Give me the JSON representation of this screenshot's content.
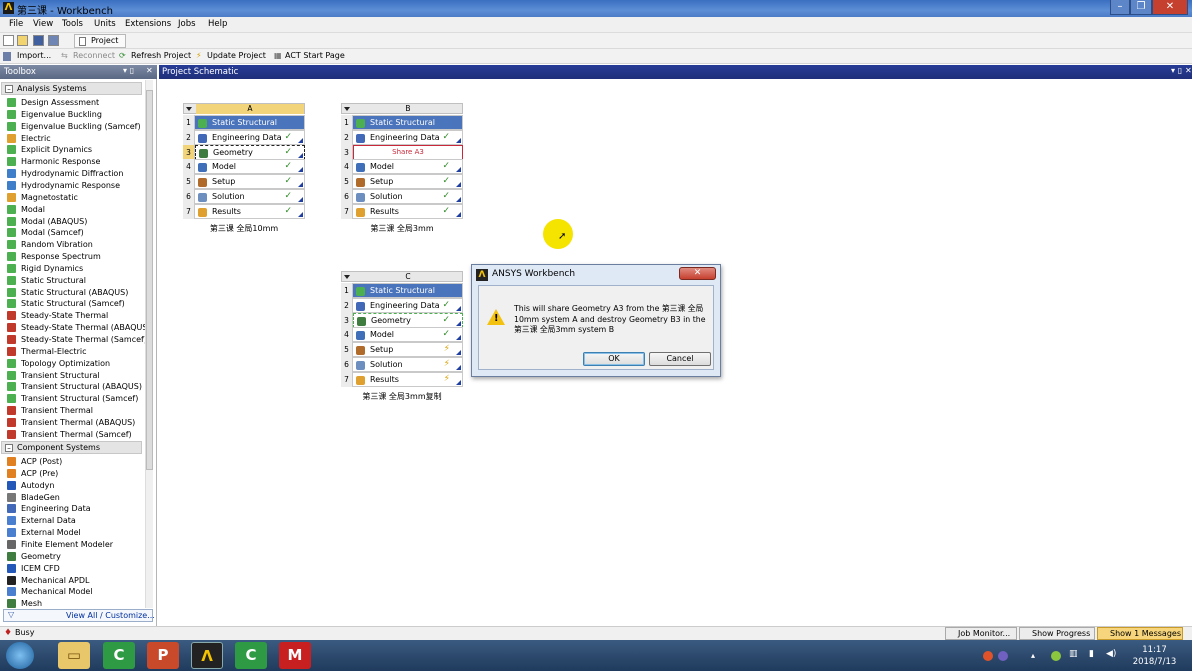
{
  "window": {
    "title": "第三课 - Workbench"
  },
  "menu": [
    "File",
    "View",
    "Tools",
    "Units",
    "Extensions",
    "Jobs",
    "Help"
  ],
  "toolbar1": {
    "project_tab": "Project"
  },
  "toolbar2": {
    "import": "Import...",
    "reconnect": "Reconnect",
    "refresh": "Refresh Project",
    "update": "Update Project",
    "act": "ACT Start Page"
  },
  "toolbox": {
    "title": "Toolbox",
    "analysis_header": "Analysis Systems",
    "analysis_items": [
      "Design Assessment",
      "Eigenvalue Buckling",
      "Eigenvalue Buckling (Samcef)",
      "Electric",
      "Explicit Dynamics",
      "Harmonic Response",
      "Hydrodynamic Diffraction",
      "Hydrodynamic Response",
      "Magnetostatic",
      "Modal",
      "Modal (ABAQUS)",
      "Modal (Samcef)",
      "Random Vibration",
      "Response Spectrum",
      "Rigid Dynamics",
      "Static Structural",
      "Static Structural (ABAQUS)",
      "Static Structural (Samcef)",
      "Steady-State Thermal",
      "Steady-State Thermal (ABAQUS)",
      "Steady-State Thermal (Samcef)",
      "Thermal-Electric",
      "Topology Optimization",
      "Transient Structural",
      "Transient Structural (ABAQUS)",
      "Transient Structural (Samcef)",
      "Transient Thermal",
      "Transient Thermal (ABAQUS)",
      "Transient Thermal (Samcef)"
    ],
    "component_header": "Component Systems",
    "component_items": [
      "ACP (Post)",
      "ACP (Pre)",
      "Autodyn",
      "BladeGen",
      "Engineering Data",
      "External Data",
      "External Model",
      "Finite Element Modeler",
      "Geometry",
      "ICEM CFD",
      "Mechanical APDL",
      "Mechanical Model",
      "Mesh"
    ],
    "view_all": "View All / Customize..."
  },
  "schematic": {
    "title": "Project Schematic",
    "systems": [
      {
        "letter": "A",
        "caption": "第三课 全局10mm",
        "rows": [
          {
            "n": "1",
            "label": "Static Structural",
            "check": ""
          },
          {
            "n": "2",
            "label": "Engineering Data",
            "check": "✓"
          },
          {
            "n": "3",
            "label": "Geometry",
            "check": "✓"
          },
          {
            "n": "4",
            "label": "Model",
            "check": "✓"
          },
          {
            "n": "5",
            "label": "Setup",
            "check": "✓"
          },
          {
            "n": "6",
            "label": "Solution",
            "check": "✓"
          },
          {
            "n": "7",
            "label": "Results",
            "check": "✓"
          }
        ]
      },
      {
        "letter": "B",
        "caption": "第三课 全局3mm",
        "rows": [
          {
            "n": "1",
            "label": "Static Structural",
            "check": ""
          },
          {
            "n": "2",
            "label": "Engineering Data",
            "check": "✓"
          },
          {
            "n": "3",
            "label": "Share A3",
            "check": ""
          },
          {
            "n": "4",
            "label": "Model",
            "check": "✓"
          },
          {
            "n": "5",
            "label": "Setup",
            "check": "✓"
          },
          {
            "n": "6",
            "label": "Solution",
            "check": "✓"
          },
          {
            "n": "7",
            "label": "Results",
            "check": "✓"
          }
        ]
      },
      {
        "letter": "C",
        "caption": "第三课 全局3mm复制",
        "rows": [
          {
            "n": "1",
            "label": "Static Structural",
            "check": ""
          },
          {
            "n": "2",
            "label": "Engineering Data",
            "check": "✓"
          },
          {
            "n": "3",
            "label": "Geometry",
            "check": "✓"
          },
          {
            "n": "4",
            "label": "Model",
            "check": "✓"
          },
          {
            "n": "5",
            "label": "Setup",
            "check": "⚡"
          },
          {
            "n": "6",
            "label": "Solution",
            "check": "⚡"
          },
          {
            "n": "7",
            "label": "Results",
            "check": "⚡"
          }
        ]
      }
    ]
  },
  "dialog": {
    "title": "ANSYS Workbench",
    "message": "This will share Geometry A3 from the 第三课 全局 10mm system A and destroy Geometry B3 in the 第三课 全局3mm system B",
    "ok": "OK",
    "cancel": "Cancel"
  },
  "status": {
    "busy": "Busy",
    "job_monitor": "Job Monitor...",
    "show_progress": "Show Progress",
    "messages": "Show 1 Messages"
  },
  "taskbar": {
    "time": "11:17",
    "date": "2018/7/13"
  }
}
